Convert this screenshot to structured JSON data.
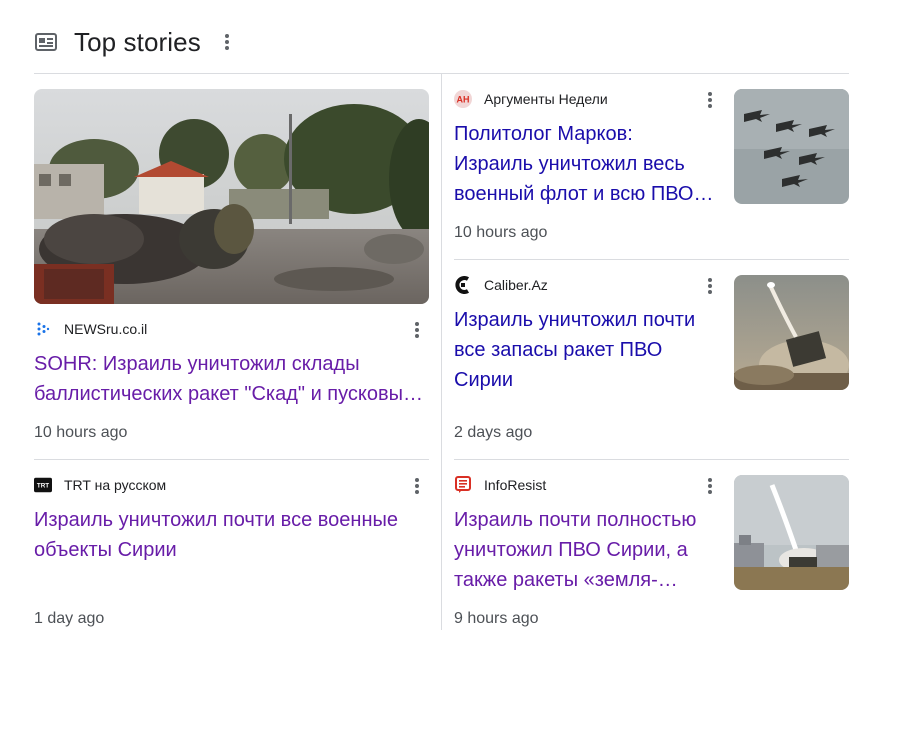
{
  "header": {
    "title": "Top stories",
    "icon": "news-icon",
    "menu_icon": "more-vert-icon"
  },
  "stories": [
    {
      "source": "NEWSru.co.il",
      "logo": "newsru-logo",
      "headline": "SOHR: Израиль уничтожил склады баллистических ракет \"Скад\" и пусковы…",
      "time": "10 hours ago",
      "visited": true,
      "image": "destroyed-military-vehicles-photo"
    },
    {
      "source": "TRT на русском",
      "logo": "trt-logo",
      "headline": "Израиль уничтожил почти все военные объекты Сирии",
      "time": "1 day ago",
      "visited": true
    },
    {
      "source": "Аргументы Недели",
      "logo": "an-logo",
      "headline": "Политолог Марков: Израиль уничтожил весь военный флот и всю ПВО Сирии",
      "time": "10 hours ago",
      "visited": false,
      "image": "fighter-jets-formation-photo"
    },
    {
      "source": "Caliber.Az",
      "logo": "caliber-logo",
      "headline": "Израиль уничтожил почти все запасы ракет ПВО Сирии",
      "time": "2 days ago",
      "visited": false,
      "image": "missile-launch-photo"
    },
    {
      "source": "InfoResist",
      "logo": "inforesist-logo",
      "headline": "Израиль почти полностью уничтожил ПВО Сирии, а также ракеты «земля-…",
      "time": "9 hours ago",
      "visited": true,
      "image": "iron-dome-launch-photo"
    }
  ],
  "colors": {
    "link": "#1a0dab",
    "visited_link": "#681da8",
    "meta_text": "#4d5156",
    "divider": "#dadce0"
  }
}
